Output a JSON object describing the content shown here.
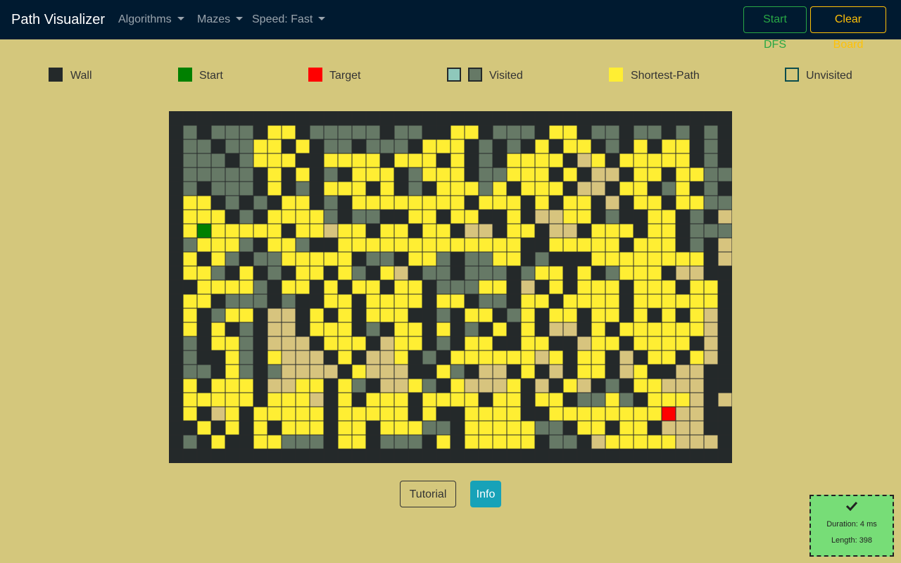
{
  "navbar": {
    "brand": "Path Visualizer",
    "menus": [
      {
        "label": "Algorithms"
      },
      {
        "label": "Mazes"
      },
      {
        "label": "Speed: Fast"
      }
    ],
    "start_button": "Start DFS",
    "clear_button": "Clear Board"
  },
  "legend": {
    "wall": "Wall",
    "start": "Start",
    "target": "Target",
    "visited": "Visited",
    "shortest_path": "Shortest-Path",
    "unvisited": "Unvisited"
  },
  "colors": {
    "background": "#d4c77c",
    "navbar": "#001a30",
    "wall": "#24292a",
    "visited_grey": "#667966",
    "visited_tan": "#d7c47e",
    "visited_legend_teal": "#8fc8bb",
    "shortest_path": "#ffee33",
    "start": "#008000",
    "target": "#ff0000",
    "start_button": "#28a745",
    "clear_button": "#ffc107",
    "info_button": "#17a2b8",
    "result_panel": "#77dd77"
  },
  "grid": {
    "legend_codes": {
      "#": "wall",
      "g": "visited",
      "t": "visited",
      "y": "shortest-path",
      "S": "start",
      "T": "target",
      ".": "unvisited"
    },
    "rows": [
      "########################################",
      "#g#ggg#yy#ggggg#gg##yy#ggg#yy#gg#gg#g#g#",
      "#gg#ggyy#y#gg#ggg#yyy#g#g#y#yy#g#y#yy#g#",
      "#ggg#gyyy##yyyy#yyy#y#g#yyyy#ty#yyyyy#g#",
      "#ggggg#y#y#g#yyy#gyyy#ggyyy#y#tt#yy#yygg#",
      "#g#ggg#y#g#yyy#y#g#yyygy#yyy#tt#yy#gy#g#",
      "#yy#g#g#yy#g#yyyyyyyy#yyy#y#yy#t#yy#yygg#",
      "#yyy#g#yyyyg#gg##yy#yy##y#ttyy#g##yy#g#t#",
      "#ySyyyyy#yytyy#yy#yy#tt#yy#tt#yyy#yy#ggg#",
      "#gyyyg#yyg##yyyyyyyyyyyyy##yyyyy#yyy#g#t#",
      "#y#yg#ggyyyyy#gg#yyg#ggyy#g###yyyyyyyy#t#",
      "#yyg#y#g#yy#yg#yt#gg#ggg#gyy#y#gyyy#tt##",
      "##yyyyg#yy#y#yy#yy#gggyy#t#y#yyy#yyy#yy#t#",
      "#yy#ggg#g##yy#yyyy#yy#gg#yy#yyyy#yyyyyy#t#",
      "#y#gyy#tt#y#y#yyy##g#yy#gy#yy#yy#y#y#yt#",
      "#y#y#g#tt#yyy#g#yy#y#g#y#y#tt#y#yyyyyyt#",
      "#g#yyg#ttt#yyy#tyy#g#yy##yy##tyy#yyyy#t#",
      "#g##yg#yttt#y#tty#g#yyyyyyty#yy#t#yy#yt#",
      "#gg#yg#gtttt#yttt##yg#tt#y#t#yy#ty##tt#",
      "#y#yyy#ttyy#yg#ttyg#yttty#t#yt#g#yyttt#",
      "#yyyyy#yyyt#y#yyy#yyyy#yy#yy#ggyg#yyyt#t#",
      "#y#ty#yyyyy#yyyyy#y##yyyy##yyyyyyyyTtt#",
      "##y#y#y#yyy#yy#yyygg#yyyyygg#yy#yy#ttt#",
      "#g#y##yyggg#yy#ggg#y#yyyyy#gg#tyyyyyttt#",
      "########################################"
    ]
  },
  "buttons": {
    "tutorial": "Tutorial",
    "info": "Info"
  },
  "result": {
    "icon": "check-icon",
    "duration": "Duration: 4 ms",
    "length": "Length: 398"
  }
}
